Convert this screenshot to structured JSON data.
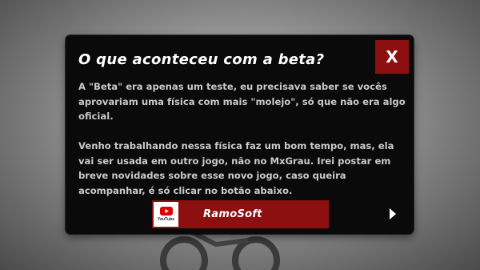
{
  "dialog": {
    "title": "O que aconteceu com a beta?",
    "close_label": "X",
    "paragraphs": [
      "A \"Beta\" era apenas um teste, eu precisava saber se vocês aprovariam uma física com mais \"molejo\", só que não era algo oficial.",
      "Venho trabalhando nessa física faz um bom tempo, mas, ela vai ser usada em outro jogo, não no MxGrau. Irei postar em breve novidades sobre esse novo jogo, caso queira acompanhar, é só clicar no botão abaixo."
    ],
    "channel_button": {
      "icon": "youtube-icon",
      "icon_label": "YouTube",
      "label": "RamoSoft"
    },
    "next_icon": "play-arrow-icon"
  },
  "colors": {
    "dialog_bg": "#0a0a0a",
    "accent_red": "#8c1010",
    "title_text": "#ffffff",
    "body_text": "#c9c9c9"
  }
}
